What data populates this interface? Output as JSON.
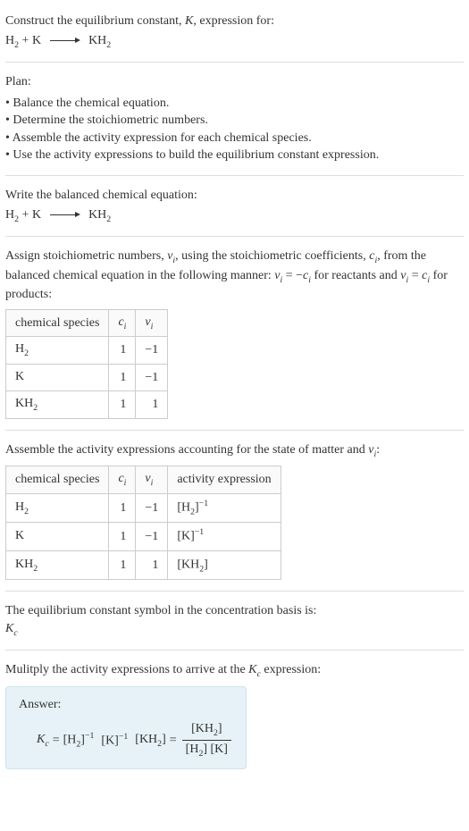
{
  "intro": {
    "line1": "Construct the equilibrium constant, ",
    "K": "K",
    "line1_end": ", expression for:"
  },
  "equation": {
    "r1": "H",
    "r1_sub": "2",
    "plus": " + ",
    "r2": "K",
    "p1": "KH",
    "p1_sub": "2"
  },
  "plan": {
    "header": "Plan:",
    "items": [
      "Balance the chemical equation.",
      "Determine the stoichiometric numbers.",
      "Assemble the activity expression for each chemical species.",
      "Use the activity expressions to build the equilibrium constant expression."
    ]
  },
  "balanced": {
    "header": "Write the balanced chemical equation:"
  },
  "assign": {
    "text1": "Assign stoichiometric numbers, ",
    "nu": "ν",
    "sub_i": "i",
    "text2": ", using the stoichiometric coefficients, ",
    "c": "c",
    "text3": ", from the balanced chemical equation in the following manner: ",
    "eq1_lhs": "ν",
    "eq1_eq": " = −",
    "text4": " for reactants and ",
    "eq2_eq": " = ",
    "text5": " for products:"
  },
  "table1": {
    "headers": {
      "h1": "chemical species",
      "h2_c": "c",
      "h2_i": "i",
      "h3_n": "ν",
      "h3_i": "i"
    },
    "rows": [
      {
        "species": "H",
        "sub": "2",
        "c": "1",
        "nu": "−1"
      },
      {
        "species": "K",
        "sub": "",
        "c": "1",
        "nu": "−1"
      },
      {
        "species": "KH",
        "sub": "2",
        "c": "1",
        "nu": "1"
      }
    ]
  },
  "activity_header": {
    "text1": "Assemble the activity expressions accounting for the state of matter and ",
    "nu": "ν",
    "sub_i": "i",
    "colon": ":"
  },
  "table2": {
    "headers": {
      "h1": "chemical species",
      "h2_c": "c",
      "h2_i": "i",
      "h3_n": "ν",
      "h3_i": "i",
      "h4": "activity expression"
    },
    "rows": [
      {
        "species": "H",
        "sub": "2",
        "c": "1",
        "nu": "−1",
        "act_open": "[H",
        "act_sub": "2",
        "act_close": "]",
        "act_exp": "−1"
      },
      {
        "species": "K",
        "sub": "",
        "c": "1",
        "nu": "−1",
        "act_open": "[K",
        "act_sub": "",
        "act_close": "]",
        "act_exp": "−1"
      },
      {
        "species": "KH",
        "sub": "2",
        "c": "1",
        "nu": "1",
        "act_open": "[KH",
        "act_sub": "2",
        "act_close": "]",
        "act_exp": ""
      }
    ]
  },
  "symbol_section": {
    "text": "The equilibrium constant symbol in the concentration basis is:",
    "K": "K",
    "sub_c": "c"
  },
  "multiply": {
    "text1": "Mulitply the activity expressions to arrive at the ",
    "K": "K",
    "sub_c": "c",
    "text2": " expression:"
  },
  "answer": {
    "label": "Answer:",
    "Kc_K": "K",
    "Kc_c": "c",
    "eq": " = ",
    "t1": "[H",
    "t1_sub": "2",
    "t1_close": "]",
    "t1_exp": "−1",
    "sp": " ",
    "t2": "[K]",
    "t2_exp": "−1",
    "t3": "[KH",
    "t3_sub": "2",
    "t3_close": "]",
    "eq2": " = ",
    "num": "[KH",
    "num_sub": "2",
    "num_close": "]",
    "den1": "[H",
    "den1_sub": "2",
    "den1_close": "]",
    "den_sp": " ",
    "den2": "[K]"
  }
}
